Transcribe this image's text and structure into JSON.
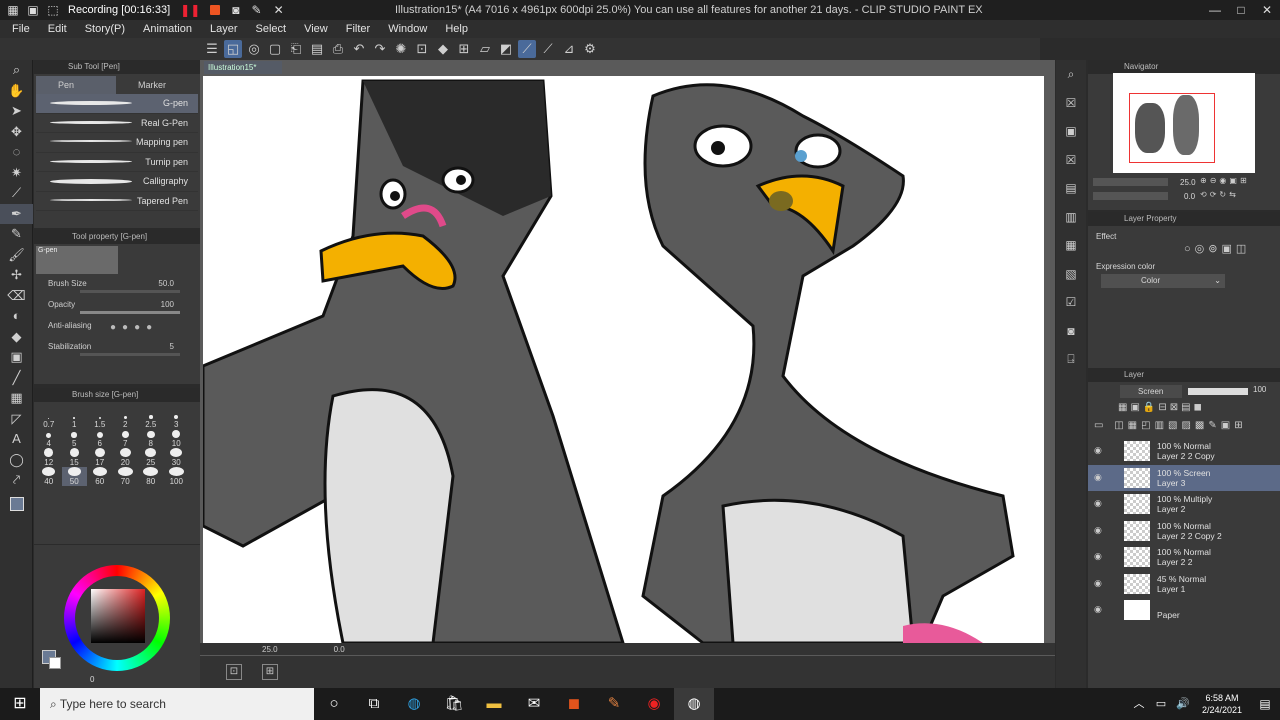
{
  "titlebar": {
    "recording_label": "Recording [00:16:33]",
    "window_title": "Illustration15* (A4 7016 x 4961px 600dpi 25.0%)  You can use all features for another 21 days. - CLIP STUDIO PAINT EX",
    "min": "—",
    "max": "□",
    "close": "✕"
  },
  "menu": [
    "File",
    "Edit",
    "Story(P)",
    "Animation",
    "Layer",
    "Select",
    "View",
    "Filter",
    "Window",
    "Help"
  ],
  "subtool": {
    "header": "Sub Tool [Pen]",
    "tabs": [
      "Pen",
      "Marker"
    ],
    "brushes": [
      "G-pen",
      "Real G-Pen",
      "Mapping pen",
      "Turnip pen",
      "Calligraphy",
      "Tapered Pen"
    ]
  },
  "toolprop": {
    "header": "Tool property [G-pen]",
    "preset_name": "G-pen",
    "brush_size_label": "Brush Size",
    "brush_size_value": "50.0",
    "opacity_label": "Opacity",
    "opacity_value": "100",
    "antialias_label": "Anti-aliasing",
    "stabilization_label": "Stabilization",
    "stabilization_value": "5"
  },
  "brushsize": {
    "header": "Brush size [G-pen]",
    "sizes": [
      "0.7",
      "1",
      "1.5",
      "2",
      "2.5",
      "3",
      "4",
      "5",
      "6",
      "7",
      "8",
      "10",
      "12",
      "15",
      "17",
      "20",
      "25",
      "30",
      "40",
      "50",
      "60",
      "70",
      "80",
      "100"
    ]
  },
  "color": {
    "main": "#6a7a94",
    "sub": "#ffffff",
    "indicator": "0"
  },
  "canvas": {
    "doc_tab": "Illustration15*",
    "zoom": "25.0",
    "rotation": "0.0"
  },
  "navigator": {
    "header": "Navigator",
    "zoom": "25.0",
    "rotation": "0.0"
  },
  "layerprop": {
    "header": "Layer Property",
    "effect_label": "Effect",
    "expression_label": "Expression color",
    "expression_value": "Color"
  },
  "layerpanel": {
    "header": "Layer",
    "blend_mode": "Screen",
    "opacity": "100",
    "layers": [
      {
        "line1": "100 % Normal",
        "line2": "Layer 2 2 Copy",
        "active": false
      },
      {
        "line1": "100 % Screen",
        "line2": "Layer 3",
        "active": true
      },
      {
        "line1": "100 % Multiply",
        "line2": "Layer 2",
        "active": false
      },
      {
        "line1": "100 % Normal",
        "line2": "Layer 2 2 Copy 2",
        "active": false
      },
      {
        "line1": "100 % Normal",
        "line2": "Layer 2 2",
        "active": false
      },
      {
        "line1": "45 % Normal",
        "line2": "Layer 1",
        "active": false
      },
      {
        "line1": "",
        "line2": "Paper",
        "active": false
      }
    ]
  },
  "taskbar": {
    "search_placeholder": "Type here to search",
    "time": "6:58 AM",
    "date": "2/24/2021"
  }
}
